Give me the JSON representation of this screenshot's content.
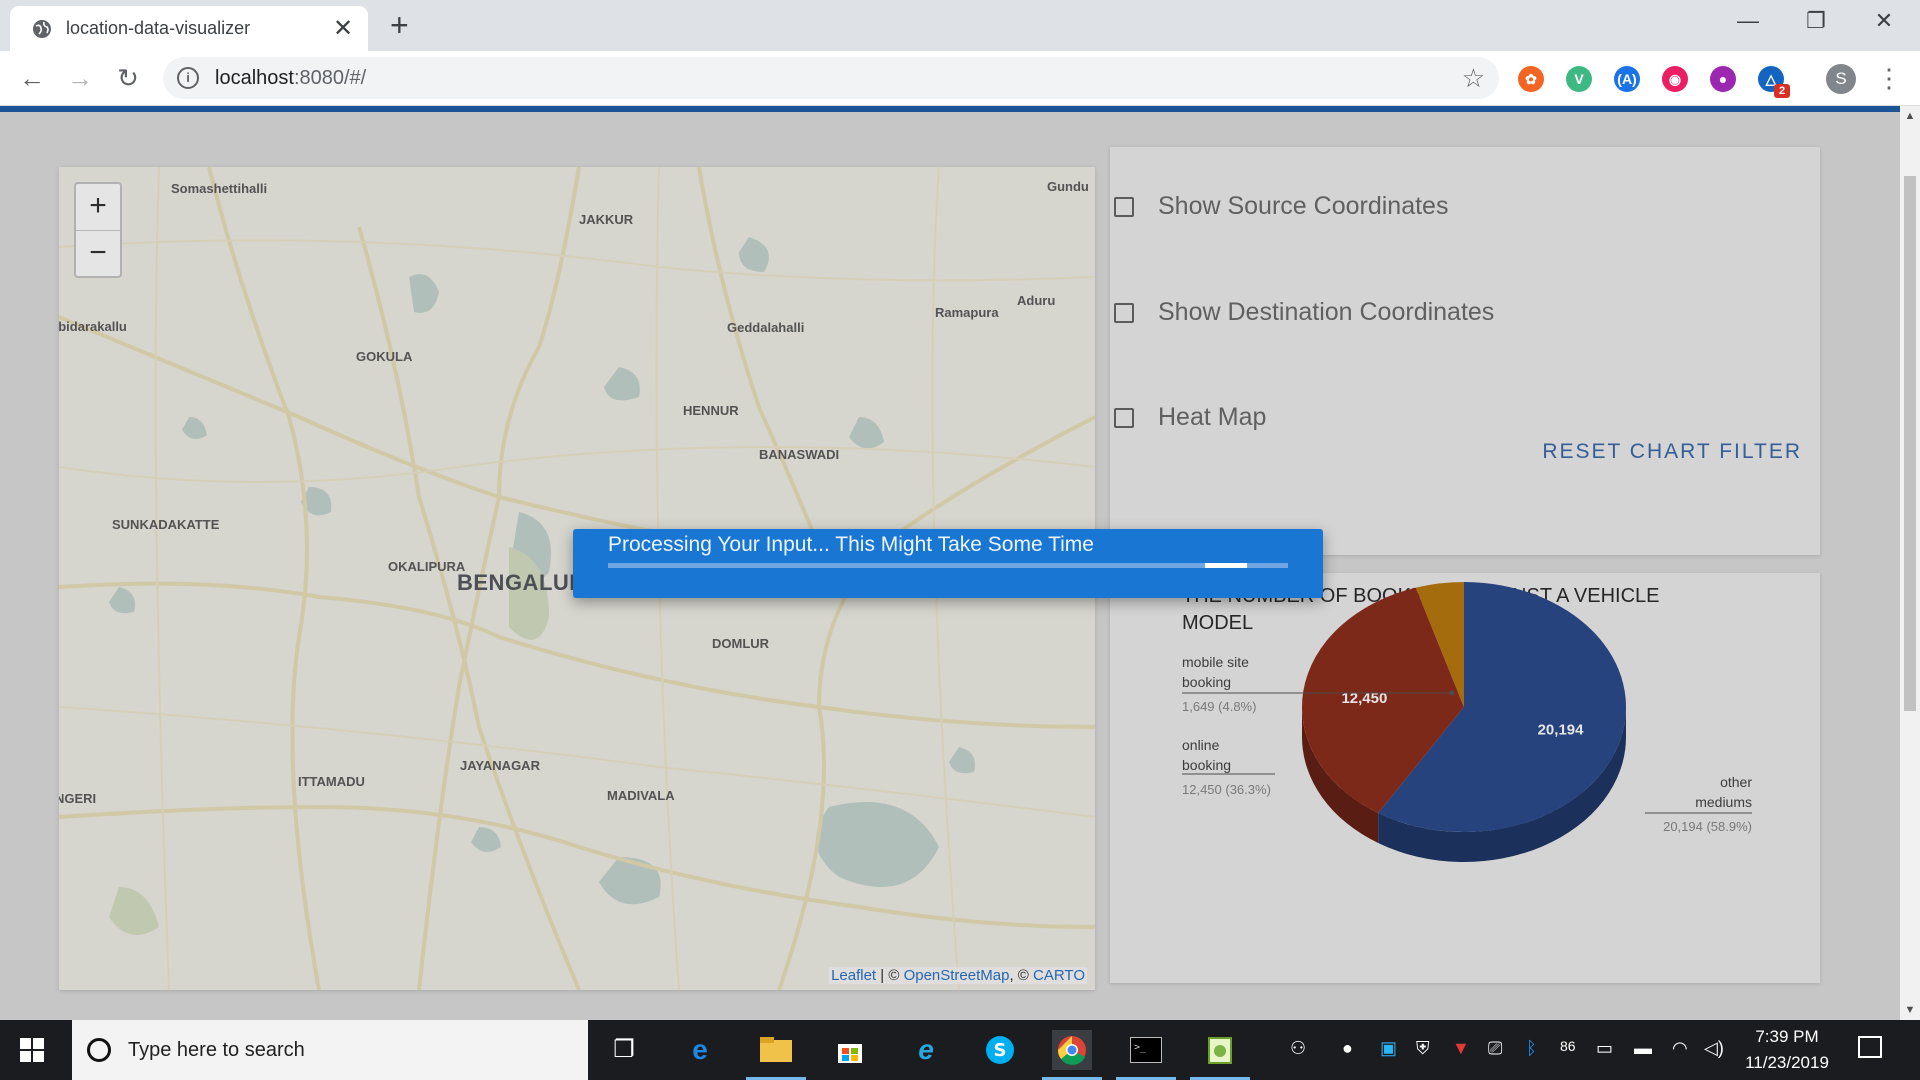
{
  "browser": {
    "tab_title": "location-data-visualizer",
    "tab_close": "✕",
    "new_tab": "+",
    "window_controls": [
      "—",
      "❐",
      "✕"
    ],
    "nav": {
      "back": "←",
      "forward": "→",
      "reload": "↻"
    },
    "url_host": "localhost",
    "url_rest": ":8080/#/",
    "bookmark_icon": "☆",
    "extensions": [
      {
        "name": "extension-orange-icon",
        "color": "#f26522",
        "glyph": "✿"
      },
      {
        "name": "vue-devtools-icon",
        "color": "#3fb984",
        "glyph": "V"
      },
      {
        "name": "angular-extension-icon",
        "color": "#1a73e8",
        "glyph": "(A)"
      },
      {
        "name": "extension-pink-icon",
        "color": "#e91e63",
        "glyph": "◉"
      },
      {
        "name": "extension-multicolor-icon",
        "color": "#9c27b0",
        "glyph": "●"
      },
      {
        "name": "extension-badge-icon",
        "color": "#1565c0",
        "glyph": "△",
        "badge": "2"
      }
    ],
    "avatar_letter": "S",
    "menu_icon": "⋮"
  },
  "map": {
    "zoom_in": "+",
    "zoom_out": "−",
    "labels": [
      {
        "text": "Somashettihalli",
        "cls": ""
      },
      {
        "text": "Gundu",
        "cls": ""
      },
      {
        "text": "JAKKUR",
        "cls": ""
      },
      {
        "text": "Aduru",
        "cls": ""
      },
      {
        "text": "Ramapura",
        "cls": ""
      },
      {
        "text": "abidarakallu",
        "cls": ""
      },
      {
        "text": "Geddalahalli",
        "cls": ""
      },
      {
        "text": "GOKULA",
        "cls": ""
      },
      {
        "text": "HENNUR",
        "cls": ""
      },
      {
        "text": "BANASWADI",
        "cls": ""
      },
      {
        "text": "SUNKADAKATTE",
        "cls": ""
      },
      {
        "text": "OKALIPURA",
        "cls": ""
      },
      {
        "text": "BENGALURU",
        "cls": "city"
      },
      {
        "text": "DOMLUR",
        "cls": ""
      },
      {
        "text": "JAYANAGAR",
        "cls": ""
      },
      {
        "text": "ITTAMADU",
        "cls": ""
      },
      {
        "text": "MADIVALA",
        "cls": ""
      },
      {
        "text": "NGERI",
        "cls": ""
      }
    ],
    "attribution": {
      "leaflet": "Leaflet",
      "sep1": " | © ",
      "osm": "OpenStreetMap",
      "sep2": ", © ",
      "carto": "CARTO"
    }
  },
  "filters": {
    "show_source": "Show Source Coordinates",
    "show_destination": "Show Destination Coordinates",
    "heat_map": "Heat Map",
    "reset_button": "RESET CHART FILTER"
  },
  "chart_title": "THE NUMBER OF BOOKINGS AGAINST A VEHICLE MODEL",
  "chart_data": {
    "type": "pie",
    "title": "THE NUMBER OF BOOKINGS AGAINST A VEHICLE MODEL",
    "slices": [
      {
        "label": "other mediums",
        "value": 20194,
        "percent": "58.9%",
        "color": "#2b4b8c",
        "display": "20,194",
        "outside": "20,194 (58.9%)"
      },
      {
        "label": "online booking",
        "value": 12450,
        "percent": "36.3%",
        "color": "#8c2e1e",
        "display": "12,450",
        "outside": "12,450 (36.3%)"
      },
      {
        "label": "mobile site booking",
        "value": 1649,
        "percent": "4.8%",
        "color": "#b8790f",
        "display": "",
        "outside": "1,649 (4.8%)"
      }
    ],
    "label_lines": {
      "mobile": [
        "mobile site",
        "booking"
      ],
      "online": [
        "online",
        "booking"
      ],
      "other": [
        "other",
        "mediums"
      ]
    }
  },
  "dialog": {
    "message": "Processing Your Input... This Might Take Some Time",
    "progress": 0.94
  },
  "taskbar": {
    "search_placeholder": "Type here to search",
    "time": "7:39 PM",
    "date": "11/23/2019"
  }
}
